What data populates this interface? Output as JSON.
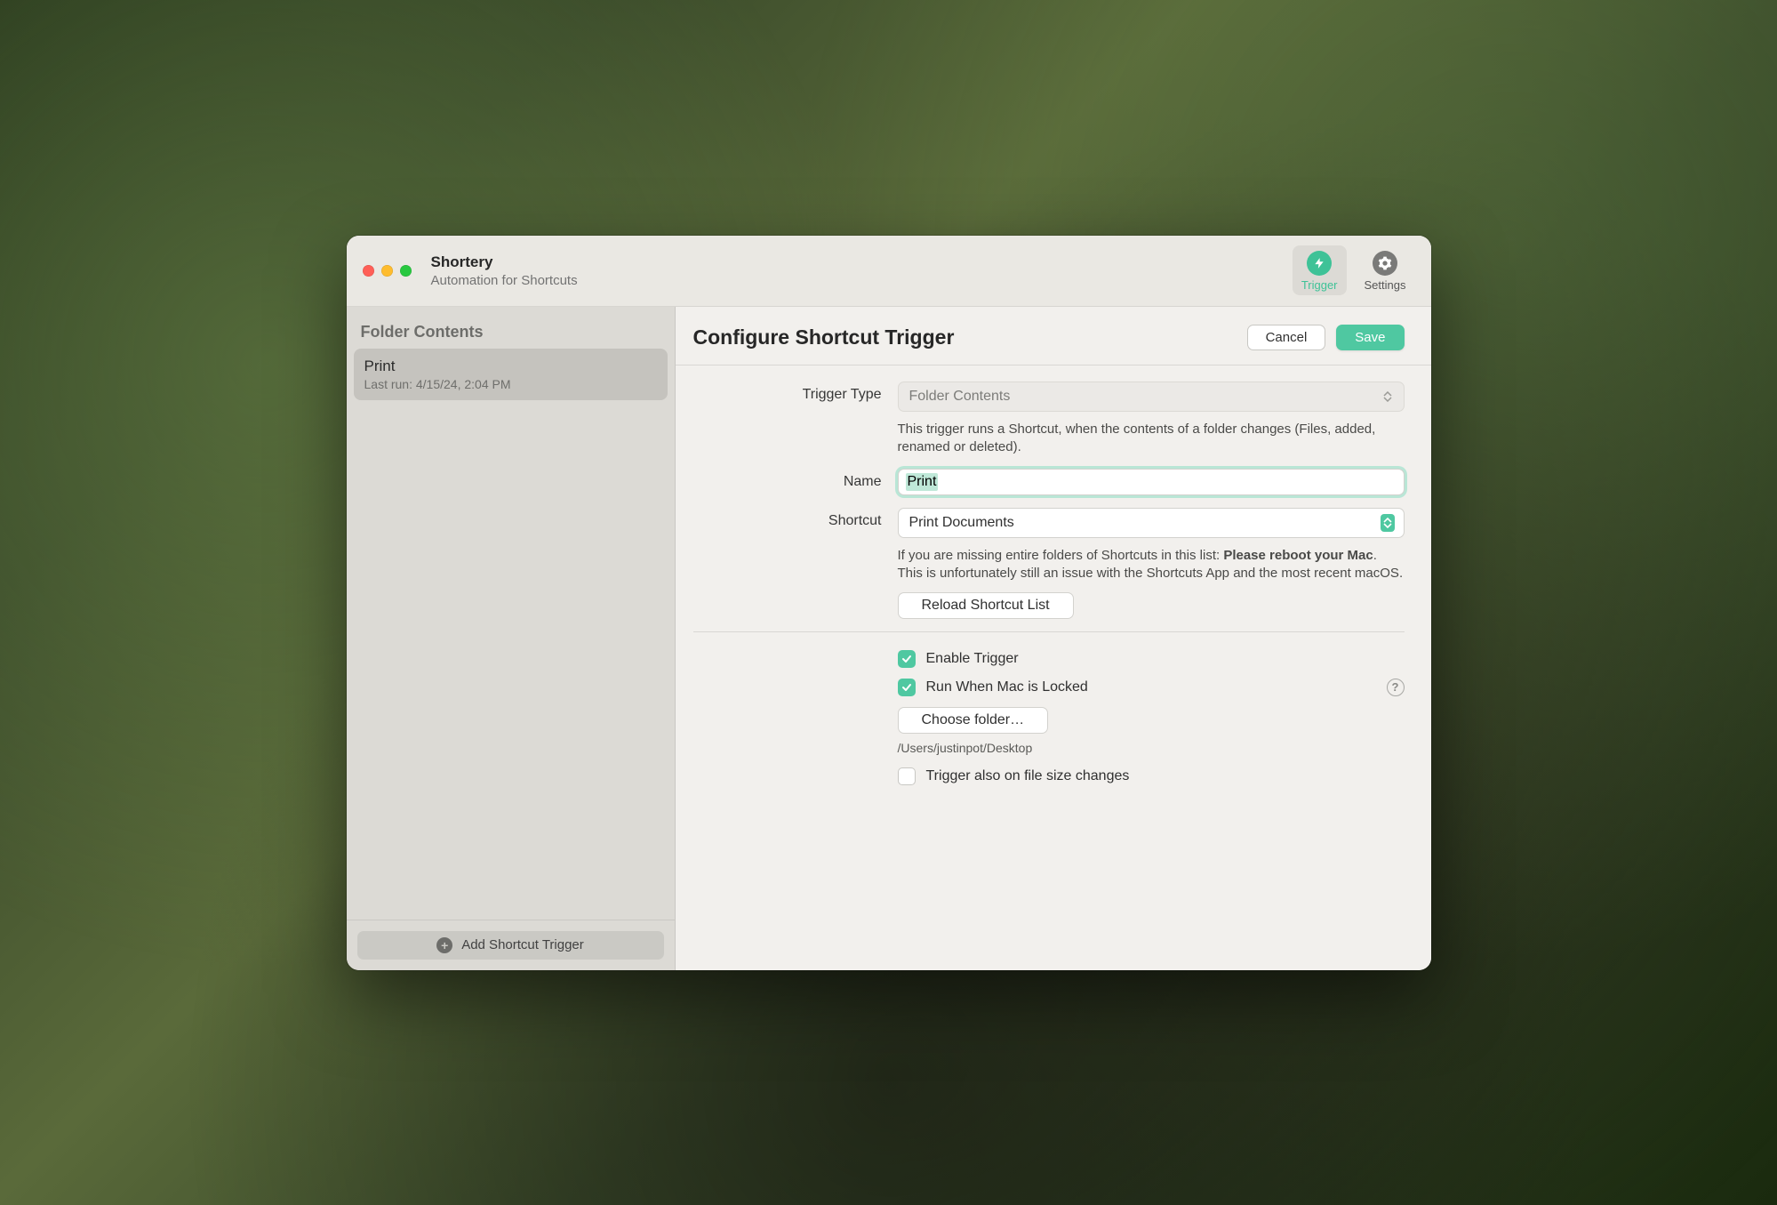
{
  "app": {
    "name": "Shortery",
    "subtitle": "Automation for Shortcuts"
  },
  "toolbar": {
    "trigger": "Trigger",
    "settings": "Settings"
  },
  "sidebar": {
    "header": "Folder Contents",
    "items": [
      {
        "title": "Print",
        "subtitle": "Last run: 4/15/24, 2:04 PM"
      }
    ],
    "add_label": "Add Shortcut Trigger"
  },
  "main": {
    "title": "Configure Shortcut Trigger",
    "cancel": "Cancel",
    "save": "Save",
    "labels": {
      "trigger_type": "Trigger Type",
      "name": "Name",
      "shortcut": "Shortcut"
    },
    "trigger_type_value": "Folder Contents",
    "trigger_type_desc": "This trigger runs a Shortcut, when the contents of a folder changes (Files, added, renamed or deleted).",
    "name_value": "Print",
    "shortcut_value": "Print Documents",
    "shortcut_note_1": "If you are missing entire folders of Shortcuts in this list: ",
    "shortcut_note_bold": "Please reboot your Mac",
    "shortcut_note_2": ". This is unfortunately still an issue with the Shortcuts App and the most recent macOS.",
    "reload": "Reload Shortcut List",
    "enable_trigger": "Enable Trigger",
    "run_when_locked": "Run When Mac is Locked",
    "choose_folder": "Choose folder…",
    "folder_path": "/Users/justinpot/Desktop",
    "trigger_on_size": "Trigger also on file size changes",
    "checks": {
      "enable": true,
      "locked": true,
      "size": false
    }
  }
}
